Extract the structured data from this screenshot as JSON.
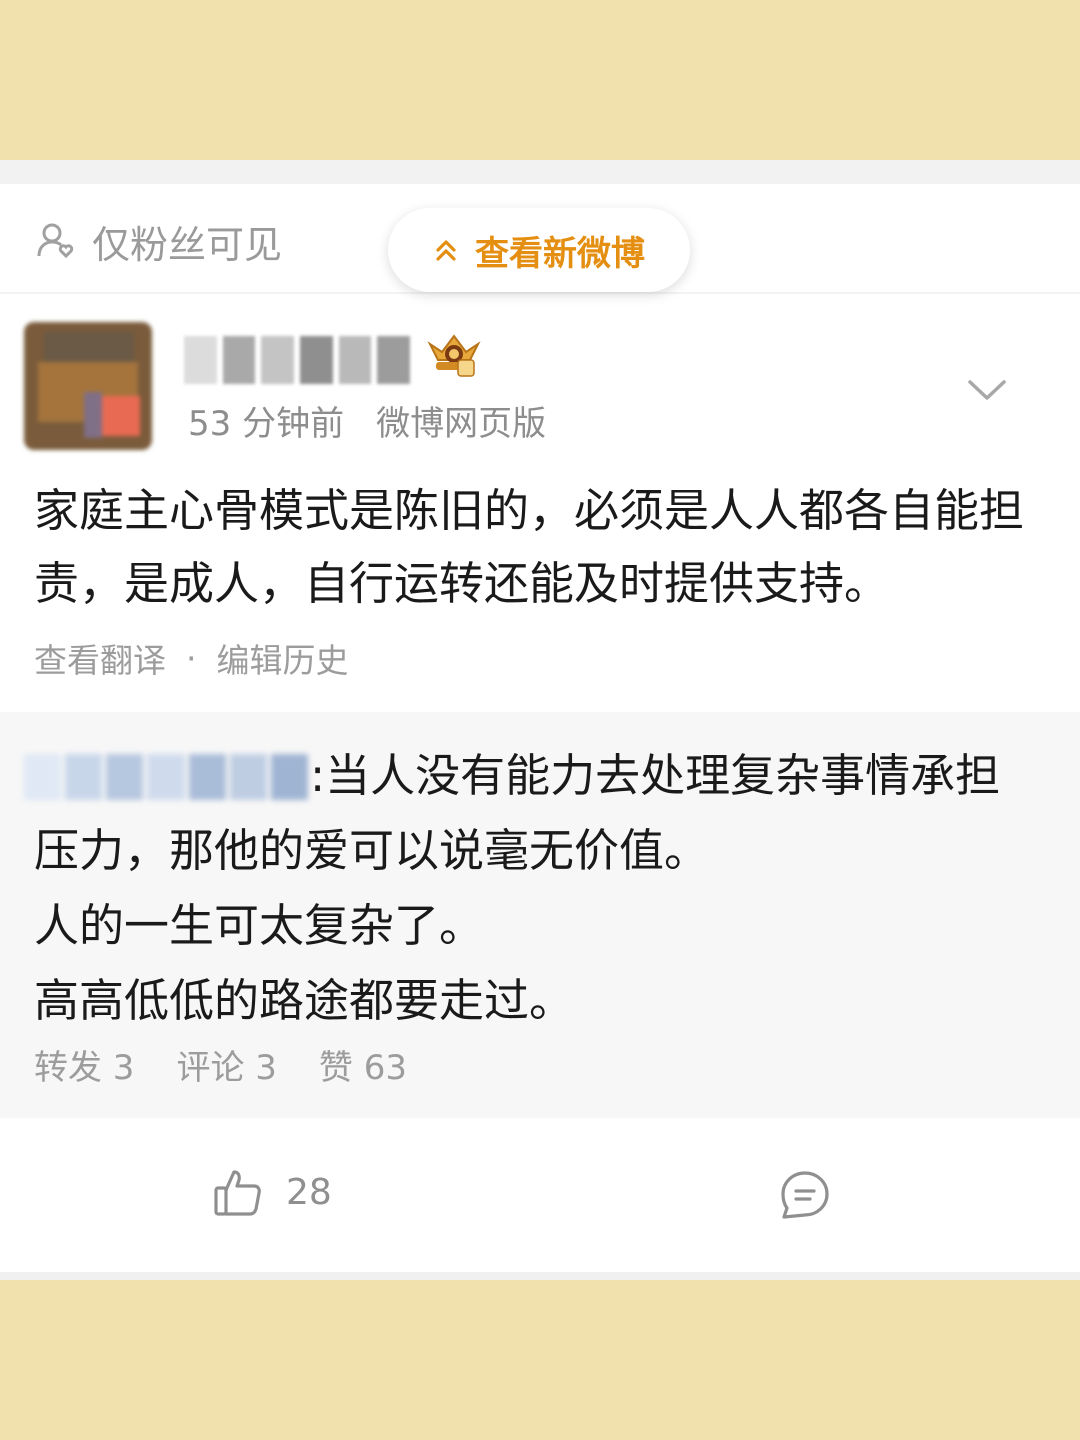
{
  "header": {
    "visibility_label": "仅粉丝可见",
    "new_posts_label": "查看新微博"
  },
  "post": {
    "time": "53 分钟前",
    "source": "微博网页版",
    "text": "家庭主心骨模式是陈旧的，必须是人人都各自能担责，是成人，自行运转还能及时提供支持。",
    "translate_label": "查看翻译",
    "separator": "·",
    "edit_history_label": "编辑历史"
  },
  "repost": {
    "line1": ":当人没有能力去处理复杂事情承担",
    "line2": "压力，那他的爱可以说毫无价值。",
    "line3": "人的一生可太复杂了。",
    "line4": "高高低低的路途都要走过。",
    "stats": {
      "forward_label": "转发 3",
      "comment_label": "评论 3",
      "like_label": "赞 63"
    }
  },
  "actions": {
    "like_count": "28"
  },
  "colors": {
    "background": "#f1e1ad",
    "accent": "#e58f12",
    "muted_text": "#9c9c9c"
  },
  "icons": [
    "user-fans-icon",
    "chevron-up-double-icon",
    "vip-crown-icon",
    "chevron-down-icon",
    "thumbs-up-icon",
    "comment-icon"
  ]
}
